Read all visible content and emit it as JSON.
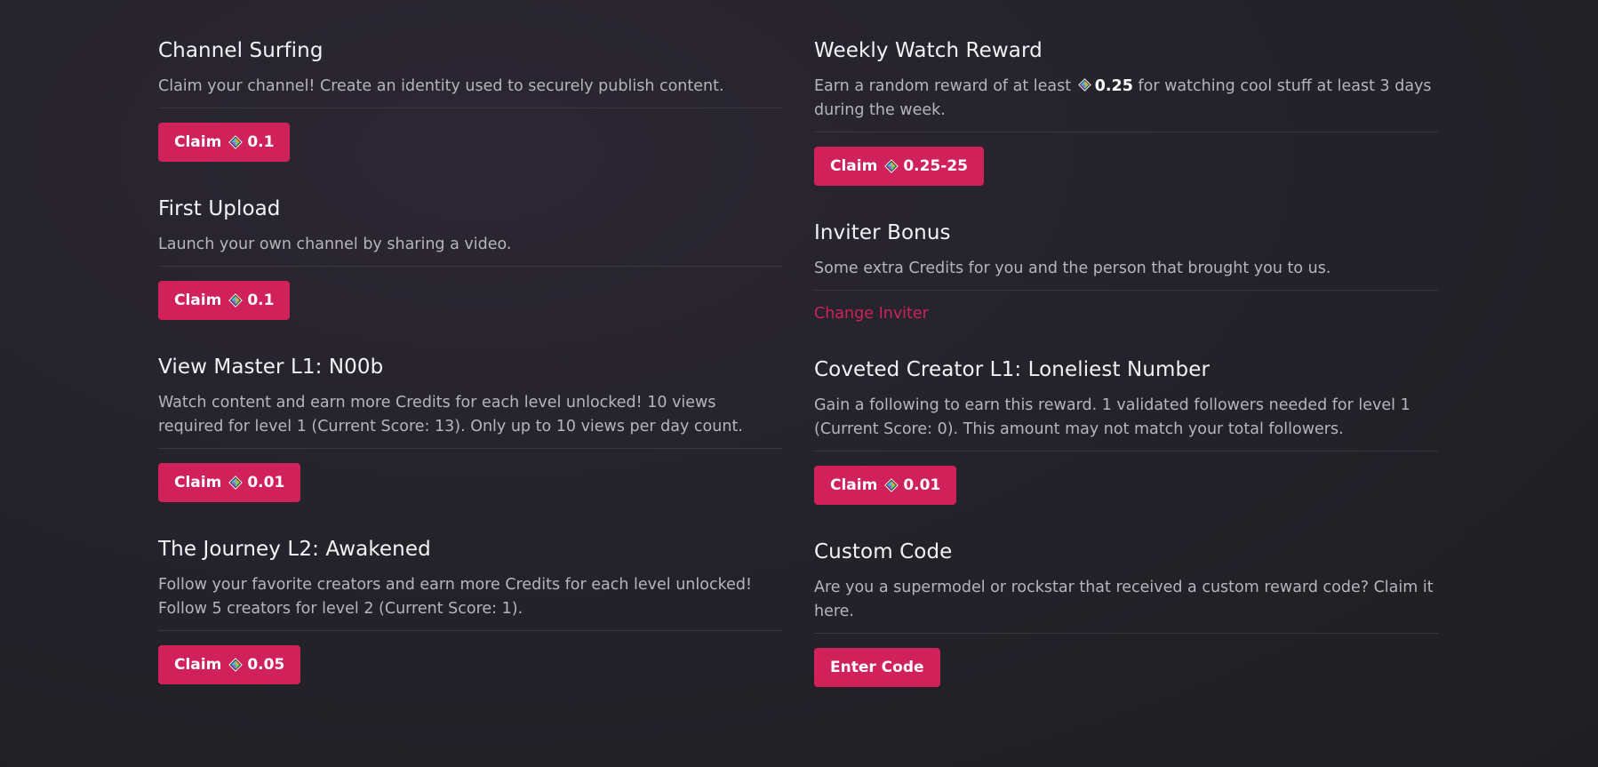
{
  "left": [
    {
      "title": "Channel Surfing",
      "desc": "Claim your channel! Create an identity used to securely publish content.",
      "button_label": "Claim",
      "amount": "0.1"
    },
    {
      "title": "First Upload",
      "desc": "Launch your own channel by sharing a video.",
      "button_label": "Claim",
      "amount": "0.1"
    },
    {
      "title": "View Master L1: N00b",
      "desc": "Watch content and earn more Credits for each level unlocked! 10 views required for level 1 (Current Score: 13). Only up to 10 views per day count.",
      "button_label": "Claim",
      "amount": "0.01"
    },
    {
      "title": "The Journey L2: Awakened",
      "desc": "Follow your favorite creators and earn more Credits for each level unlocked! Follow 5 creators for level 2 (Current Score: 1).",
      "button_label": "Claim",
      "amount": "0.05"
    }
  ],
  "right": {
    "weekly": {
      "title": "Weekly Watch Reward",
      "desc_before": "Earn a random reward of at least",
      "desc_amount": "0.25",
      "desc_after": "for watching cool stuff at least 3 days during the week.",
      "button_label": "Claim",
      "amount": "0.25-25"
    },
    "inviter": {
      "title": "Inviter Bonus",
      "desc": "Some extra Credits for you and the person that brought you to us.",
      "link": "Change Inviter"
    },
    "creator": {
      "title": "Coveted Creator L1: Loneliest Number",
      "desc": "Gain a following to earn this reward. 1 validated followers needed for level 1 (Current Score: 0). This amount may not match your total followers.",
      "button_label": "Claim",
      "amount": "0.01"
    },
    "custom": {
      "title": "Custom Code",
      "desc": "Are you a supermodel or rockstar that received a custom reward code? Claim it here.",
      "button_label": "Enter Code"
    }
  },
  "icons": {
    "credits": "lbc-credits-icon"
  },
  "colors": {
    "accent": "#d0215a",
    "background": "#252329"
  }
}
